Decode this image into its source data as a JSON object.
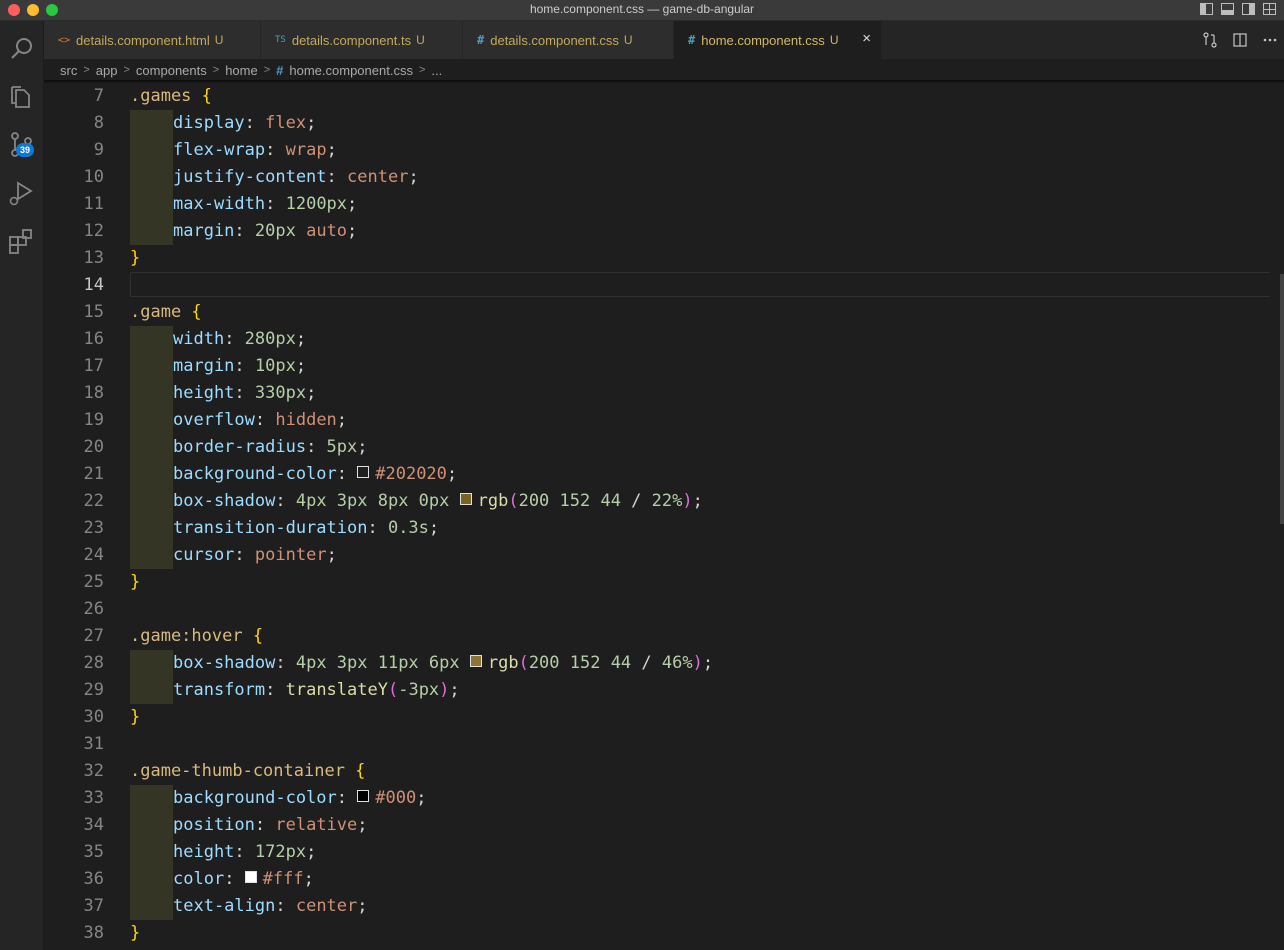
{
  "window": {
    "title": "home.component.css — game-db-angular"
  },
  "activity_bar": {
    "items": [
      {
        "name": "search-icon"
      },
      {
        "name": "explorer-icon"
      },
      {
        "name": "source-control-icon",
        "badge": "39"
      },
      {
        "name": "run-debug-icon"
      },
      {
        "name": "extensions-icon"
      }
    ]
  },
  "tabs": [
    {
      "icon": "<>",
      "label": "details.component.html",
      "status": "U",
      "icon_color": "#e37933"
    },
    {
      "icon": "TS",
      "label": "details.component.ts",
      "status": "U",
      "icon_color": "#519aba"
    },
    {
      "icon": "#",
      "label": "details.component.css",
      "status": "U",
      "icon_color": "#519aba"
    },
    {
      "icon": "#",
      "label": "home.component.css",
      "status": "U",
      "active": true,
      "close": "×",
      "icon_color": "#519aba"
    }
  ],
  "breadcrumbs": {
    "parts": [
      "src",
      "app",
      "components",
      "home"
    ],
    "file": "home.component.css",
    "tail": "..."
  },
  "editor": {
    "current_line": "14",
    "lines": [
      {
        "n": "7",
        "indent": false,
        "tokens": [
          {
            "t": "sel",
            "v": ".games "
          },
          {
            "t": "brace",
            "v": "{"
          }
        ]
      },
      {
        "n": "8",
        "indent": true,
        "tokens": [
          {
            "t": "prop",
            "v": "display"
          },
          {
            "t": "punc",
            "v": ": "
          },
          {
            "t": "val",
            "v": "flex"
          },
          {
            "t": "punc",
            "v": ";"
          }
        ]
      },
      {
        "n": "9",
        "indent": true,
        "tokens": [
          {
            "t": "prop",
            "v": "flex-wrap"
          },
          {
            "t": "punc",
            "v": ": "
          },
          {
            "t": "val",
            "v": "wrap"
          },
          {
            "t": "punc",
            "v": ";"
          }
        ]
      },
      {
        "n": "10",
        "indent": true,
        "tokens": [
          {
            "t": "prop",
            "v": "justify-content"
          },
          {
            "t": "punc",
            "v": ": "
          },
          {
            "t": "val",
            "v": "center"
          },
          {
            "t": "punc",
            "v": ";"
          }
        ]
      },
      {
        "n": "11",
        "indent": true,
        "tokens": [
          {
            "t": "prop",
            "v": "max-width"
          },
          {
            "t": "punc",
            "v": ": "
          },
          {
            "t": "num",
            "v": "1200px"
          },
          {
            "t": "punc",
            "v": ";"
          }
        ]
      },
      {
        "n": "12",
        "indent": true,
        "tokens": [
          {
            "t": "prop",
            "v": "margin"
          },
          {
            "t": "punc",
            "v": ": "
          },
          {
            "t": "num",
            "v": "20px "
          },
          {
            "t": "val",
            "v": "auto"
          },
          {
            "t": "punc",
            "v": ";"
          }
        ]
      },
      {
        "n": "13",
        "indent": false,
        "tokens": [
          {
            "t": "brace",
            "v": "}"
          }
        ]
      },
      {
        "n": "14",
        "indent": false,
        "tokens": []
      },
      {
        "n": "15",
        "indent": false,
        "tokens": [
          {
            "t": "sel",
            "v": ".game "
          },
          {
            "t": "brace",
            "v": "{"
          }
        ]
      },
      {
        "n": "16",
        "indent": true,
        "tokens": [
          {
            "t": "prop",
            "v": "width"
          },
          {
            "t": "punc",
            "v": ": "
          },
          {
            "t": "num",
            "v": "280px"
          },
          {
            "t": "punc",
            "v": ";"
          }
        ]
      },
      {
        "n": "17",
        "indent": true,
        "tokens": [
          {
            "t": "prop",
            "v": "margin"
          },
          {
            "t": "punc",
            "v": ": "
          },
          {
            "t": "num",
            "v": "10px"
          },
          {
            "t": "punc",
            "v": ";"
          }
        ]
      },
      {
        "n": "18",
        "indent": true,
        "tokens": [
          {
            "t": "prop",
            "v": "height"
          },
          {
            "t": "punc",
            "v": ": "
          },
          {
            "t": "num",
            "v": "330px"
          },
          {
            "t": "punc",
            "v": ";"
          }
        ]
      },
      {
        "n": "19",
        "indent": true,
        "tokens": [
          {
            "t": "prop",
            "v": "overflow"
          },
          {
            "t": "punc",
            "v": ": "
          },
          {
            "t": "val",
            "v": "hidden"
          },
          {
            "t": "punc",
            "v": ";"
          }
        ]
      },
      {
        "n": "20",
        "indent": true,
        "tokens": [
          {
            "t": "prop",
            "v": "border-radius"
          },
          {
            "t": "punc",
            "v": ": "
          },
          {
            "t": "num",
            "v": "5px"
          },
          {
            "t": "punc",
            "v": ";"
          }
        ]
      },
      {
        "n": "21",
        "indent": true,
        "tokens": [
          {
            "t": "prop",
            "v": "background-color"
          },
          {
            "t": "punc",
            "v": ": "
          },
          {
            "t": "swatch",
            "v": "#202020"
          },
          {
            "t": "val",
            "v": "#202020"
          },
          {
            "t": "punc",
            "v": ";"
          }
        ]
      },
      {
        "n": "22",
        "indent": true,
        "tokens": [
          {
            "t": "prop",
            "v": "box-shadow"
          },
          {
            "t": "punc",
            "v": ": "
          },
          {
            "t": "num",
            "v": "4px 3px 8px 0px "
          },
          {
            "t": "swatch",
            "v": "#7a6326"
          },
          {
            "t": "fn",
            "v": "rgb"
          },
          {
            "t": "paren",
            "v": "("
          },
          {
            "t": "num",
            "v": "200 152 44 "
          },
          {
            "t": "punc",
            "v": "/ "
          },
          {
            "t": "num",
            "v": "22%"
          },
          {
            "t": "paren",
            "v": ")"
          },
          {
            "t": "punc",
            "v": ";"
          }
        ]
      },
      {
        "n": "23",
        "indent": true,
        "tokens": [
          {
            "t": "prop",
            "v": "transition-duration"
          },
          {
            "t": "punc",
            "v": ": "
          },
          {
            "t": "num",
            "v": "0.3s"
          },
          {
            "t": "punc",
            "v": ";"
          }
        ]
      },
      {
        "n": "24",
        "indent": true,
        "tokens": [
          {
            "t": "prop",
            "v": "cursor"
          },
          {
            "t": "punc",
            "v": ": "
          },
          {
            "t": "val",
            "v": "pointer"
          },
          {
            "t": "punc",
            "v": ";"
          }
        ]
      },
      {
        "n": "25",
        "indent": false,
        "tokens": [
          {
            "t": "brace",
            "v": "}"
          }
        ]
      },
      {
        "n": "26",
        "indent": false,
        "tokens": []
      },
      {
        "n": "27",
        "indent": false,
        "tokens": [
          {
            "t": "sel",
            "v": ".game:hover "
          },
          {
            "t": "brace",
            "v": "{"
          }
        ]
      },
      {
        "n": "28",
        "indent": true,
        "tokens": [
          {
            "t": "prop",
            "v": "box-shadow"
          },
          {
            "t": "punc",
            "v": ": "
          },
          {
            "t": "num",
            "v": "4px 3px 11px 6px "
          },
          {
            "t": "swatch",
            "v": "#8c7436"
          },
          {
            "t": "fn",
            "v": "rgb"
          },
          {
            "t": "paren",
            "v": "("
          },
          {
            "t": "num",
            "v": "200 152 44 "
          },
          {
            "t": "punc",
            "v": "/ "
          },
          {
            "t": "num",
            "v": "46%"
          },
          {
            "t": "paren",
            "v": ")"
          },
          {
            "t": "punc",
            "v": ";"
          }
        ]
      },
      {
        "n": "29",
        "indent": true,
        "tokens": [
          {
            "t": "prop",
            "v": "transform"
          },
          {
            "t": "punc",
            "v": ": "
          },
          {
            "t": "fn",
            "v": "translateY"
          },
          {
            "t": "paren",
            "v": "("
          },
          {
            "t": "num",
            "v": "-3px"
          },
          {
            "t": "paren",
            "v": ")"
          },
          {
            "t": "punc",
            "v": ";"
          }
        ]
      },
      {
        "n": "30",
        "indent": false,
        "tokens": [
          {
            "t": "brace",
            "v": "}"
          }
        ]
      },
      {
        "n": "31",
        "indent": false,
        "tokens": []
      },
      {
        "n": "32",
        "indent": false,
        "tokens": [
          {
            "t": "sel",
            "v": ".game-thumb-container "
          },
          {
            "t": "brace",
            "v": "{"
          }
        ]
      },
      {
        "n": "33",
        "indent": true,
        "tokens": [
          {
            "t": "prop",
            "v": "background-color"
          },
          {
            "t": "punc",
            "v": ": "
          },
          {
            "t": "swatch",
            "v": "#000000"
          },
          {
            "t": "val",
            "v": "#000"
          },
          {
            "t": "punc",
            "v": ";"
          }
        ]
      },
      {
        "n": "34",
        "indent": true,
        "tokens": [
          {
            "t": "prop",
            "v": "position"
          },
          {
            "t": "punc",
            "v": ": "
          },
          {
            "t": "val",
            "v": "relative"
          },
          {
            "t": "punc",
            "v": ";"
          }
        ]
      },
      {
        "n": "35",
        "indent": true,
        "tokens": [
          {
            "t": "prop",
            "v": "height"
          },
          {
            "t": "punc",
            "v": ": "
          },
          {
            "t": "num",
            "v": "172px"
          },
          {
            "t": "punc",
            "v": ";"
          }
        ]
      },
      {
        "n": "36",
        "indent": true,
        "tokens": [
          {
            "t": "prop",
            "v": "color"
          },
          {
            "t": "punc",
            "v": ": "
          },
          {
            "t": "swatch",
            "v": "#ffffff"
          },
          {
            "t": "val",
            "v": "#fff"
          },
          {
            "t": "punc",
            "v": ";"
          }
        ]
      },
      {
        "n": "37",
        "indent": true,
        "tokens": [
          {
            "t": "prop",
            "v": "text-align"
          },
          {
            "t": "punc",
            "v": ": "
          },
          {
            "t": "val",
            "v": "center"
          },
          {
            "t": "punc",
            "v": ";"
          }
        ]
      },
      {
        "n": "38",
        "indent": false,
        "tokens": [
          {
            "t": "brace",
            "v": "}"
          }
        ]
      }
    ]
  }
}
